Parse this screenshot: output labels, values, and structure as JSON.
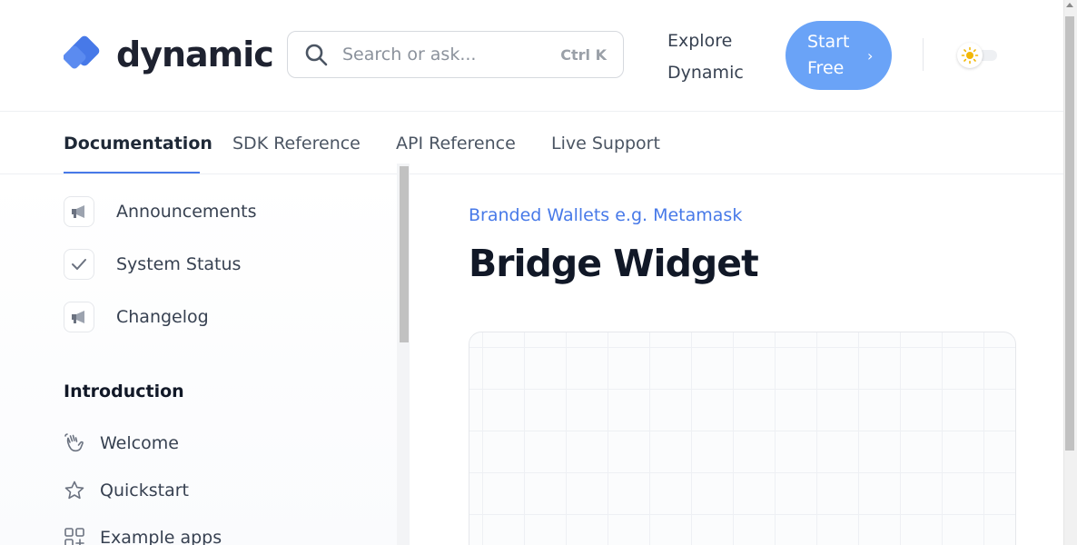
{
  "header": {
    "logo_text": "dynamic",
    "search": {
      "placeholder": "Search or ask...",
      "shortcut": "Ctrl K"
    },
    "explore_line1": "Explore",
    "explore_line2": "Dynamic",
    "start_line1": "Start",
    "start_line2": "Free",
    "theme": "light"
  },
  "tabs": [
    {
      "label": "Documentation",
      "active": true
    },
    {
      "label": "SDK Reference"
    },
    {
      "label": "API Reference"
    },
    {
      "label": "Live Support"
    }
  ],
  "sidebar": {
    "links": [
      {
        "label": "Announcements",
        "icon": "megaphone-icon"
      },
      {
        "label": "System Status",
        "icon": "check-icon"
      },
      {
        "label": "Changelog",
        "icon": "megaphone-icon"
      }
    ],
    "section_title": "Introduction",
    "items": [
      {
        "label": "Welcome",
        "icon": "waving-hand-icon"
      },
      {
        "label": "Quickstart",
        "icon": "star-icon"
      },
      {
        "label": "Example apps",
        "icon": "grid-plus-icon"
      }
    ]
  },
  "main": {
    "breadcrumb": "Branded Wallets e.g. Metamask",
    "title": "Bridge Widget"
  },
  "colors": {
    "accent": "#4779e8",
    "button": "#6aa3f7",
    "logo": "#4779e8"
  }
}
